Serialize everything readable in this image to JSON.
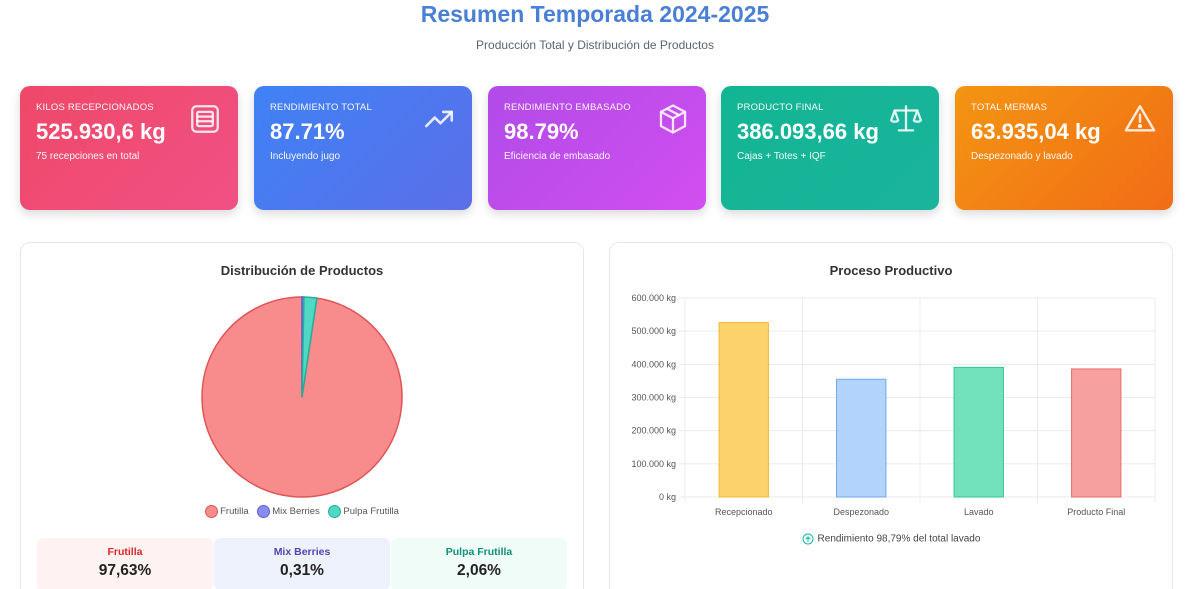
{
  "header": {
    "title": "Resumen Temporada 2024-2025",
    "subtitle": "Producción Total y Distribución de Productos"
  },
  "kpis": [
    {
      "label": "KILOS RECEPCIONADOS",
      "value": "525.930,6 kg",
      "sub": "75 recepciones en total",
      "icon": "archive-box-icon"
    },
    {
      "label": "RENDIMIENTO TOTAL",
      "value": "87.71%",
      "sub": "Incluyendo jugo",
      "icon": "trending-up-icon"
    },
    {
      "label": "RENDIMIENTO EMBASADO",
      "value": "98.79%",
      "sub": "Eficiencia de embasado",
      "icon": "cube-icon"
    },
    {
      "label": "PRODUCTO FINAL",
      "value": "386.093,66 kg",
      "sub": "Cajas + Totes + IQF",
      "icon": "scale-icon"
    },
    {
      "label": "TOTAL MERMAS",
      "value": "63.935,04 kg",
      "sub": "Despezonado y lavado",
      "icon": "warning-icon"
    }
  ],
  "distribution": {
    "title": "Distribución de Productos",
    "items": [
      {
        "name": "Frutilla",
        "pct": "97,63%"
      },
      {
        "name": "Mix Berries",
        "pct": "0,31%"
      },
      {
        "name": "Pulpa Frutilla",
        "pct": "2,06%"
      }
    ]
  },
  "process": {
    "title": "Proceso Productivo",
    "note": "Rendimiento 98,79% del total lavado"
  },
  "colors": {
    "frutilla": "#f88c8c",
    "mix_berries": "#8b8cf0",
    "pulpa": "#4fd8c4"
  },
  "chart_data": [
    {
      "type": "pie",
      "title": "Distribución de Productos",
      "categories": [
        "Frutilla",
        "Mix Berries",
        "Pulpa Frutilla"
      ],
      "values": [
        97.63,
        0.31,
        2.06
      ],
      "legend": "bottom"
    },
    {
      "type": "bar",
      "title": "Proceso Productivo",
      "categories": [
        "Recepcionado",
        "Despezonado",
        "Lavado",
        "Producto Final"
      ],
      "values": [
        525930.6,
        355000,
        390800,
        386093.66
      ],
      "ylim": [
        0,
        600000
      ],
      "yticks": [
        "0 kg",
        "100.000 kg",
        "200.000 kg",
        "300.000 kg",
        "400.000 kg",
        "500.000 kg",
        "600.000 kg"
      ],
      "grid": true
    }
  ]
}
